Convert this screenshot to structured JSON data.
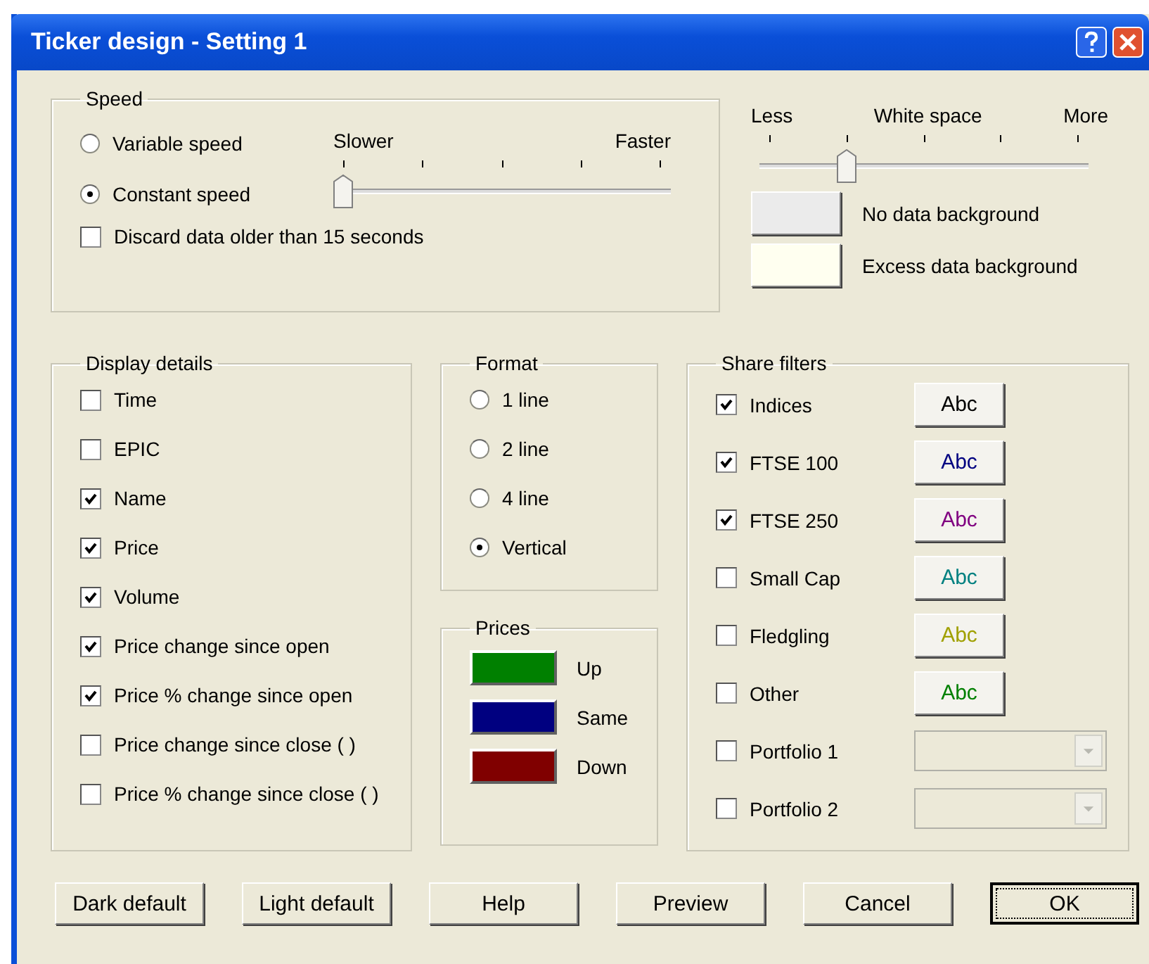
{
  "window": {
    "title": "Ticker design - Setting 1"
  },
  "speed": {
    "title": "Speed",
    "options": [
      {
        "label": "Variable speed",
        "selected": false
      },
      {
        "label": "Constant speed",
        "selected": true
      }
    ],
    "slider": {
      "min_label": "Slower",
      "max_label": "Faster",
      "level": 0
    },
    "discard": {
      "label": "Discard data older than 15 seconds",
      "checked": false
    }
  },
  "white_space": {
    "less_label": "Less",
    "label": "White space",
    "more_label": "More",
    "level": 0.25
  },
  "backgrounds": [
    {
      "label": "No data background",
      "color": "#ebebeb"
    },
    {
      "label": "Excess data background",
      "color": "#fffff0"
    }
  ],
  "display_details": {
    "title": "Display details",
    "items": [
      {
        "label": "Time",
        "checked": false
      },
      {
        "label": "EPIC",
        "checked": false
      },
      {
        "label": "Name",
        "checked": true
      },
      {
        "label": "Price",
        "checked": true
      },
      {
        "label": "Volume",
        "checked": true
      },
      {
        "label": "Price change since open",
        "checked": true
      },
      {
        "label": "Price % change since open",
        "checked": true
      },
      {
        "label": "Price change since close ( )",
        "checked": false
      },
      {
        "label": "Price % change since close ( )",
        "checked": false
      }
    ]
  },
  "format": {
    "title": "Format",
    "options": [
      {
        "label": "1 line",
        "selected": false
      },
      {
        "label": "2 line",
        "selected": false
      },
      {
        "label": "4 line",
        "selected": false
      },
      {
        "label": "Vertical",
        "selected": true
      }
    ]
  },
  "prices": {
    "title": "Prices",
    "items": [
      {
        "label": "Up",
        "color": "#008000"
      },
      {
        "label": "Same",
        "color": "#000080"
      },
      {
        "label": "Down",
        "color": "#800000"
      }
    ]
  },
  "share_filters": {
    "title": "Share filters",
    "items": [
      {
        "kind": "style",
        "label": "Indices",
        "checked": true,
        "sample": "Abc",
        "color": "#000000"
      },
      {
        "kind": "style",
        "label": "FTSE 100",
        "checked": true,
        "sample": "Abc",
        "color": "#000080"
      },
      {
        "kind": "style",
        "label": "FTSE 250",
        "checked": true,
        "sample": "Abc",
        "color": "#800080"
      },
      {
        "kind": "style",
        "label": "Small Cap",
        "checked": false,
        "sample": "Abc",
        "color": "#008080"
      },
      {
        "kind": "style",
        "label": "Fledgling",
        "checked": false,
        "sample": "Abc",
        "color": "#a0a000"
      },
      {
        "kind": "style",
        "label": "Other",
        "checked": false,
        "sample": "Abc",
        "color": "#008000"
      },
      {
        "kind": "portfolio",
        "label": "Portfolio 1",
        "checked": false
      },
      {
        "kind": "portfolio",
        "label": "Portfolio 2",
        "checked": false
      }
    ]
  },
  "buttons": [
    {
      "label": "Dark default",
      "default": false
    },
    {
      "label": "Light default",
      "default": false
    },
    {
      "label": "Help",
      "default": false
    },
    {
      "label": "Preview",
      "default": false
    },
    {
      "label": "Cancel",
      "default": false
    },
    {
      "label": "OK",
      "default": true
    }
  ]
}
